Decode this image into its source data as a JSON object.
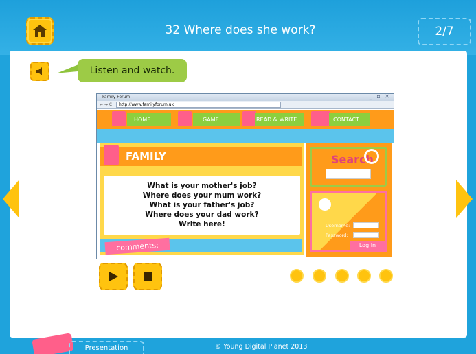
{
  "header": {
    "title": "32 Where does she work?",
    "page_indicator": "2/7"
  },
  "instruction": {
    "text": "Listen and watch."
  },
  "browser": {
    "tab_title": "Family Forum",
    "url": "http://www.familyforum.uk",
    "nav": [
      "HOME",
      "GAME",
      "READ & WRITE",
      "CONTACT"
    ],
    "section_title": "FAMILY",
    "questions": [
      "What is your mother's job?",
      "Where does your mum work?",
      "What is your father's job?",
      "Where does your dad work?",
      "Write here!"
    ],
    "comments_label": "comments:",
    "search_label": "Search",
    "username_label": "Username:",
    "password_label": "Password:",
    "login_button": "Log In"
  },
  "footer": {
    "presentation_label": "Presentation",
    "copyright": "© Young Digital Planet 2013"
  },
  "colors": {
    "accent_yellow": "#ffc30f",
    "sky_blue": "#1fa3dc",
    "orange": "#ff9b1a",
    "green": "#9dcb46",
    "pink": "#ff6fa0"
  },
  "icons": [
    "home-icon",
    "speaker-icon",
    "play-icon",
    "stop-icon",
    "arrow-left-icon",
    "arrow-right-icon"
  ]
}
